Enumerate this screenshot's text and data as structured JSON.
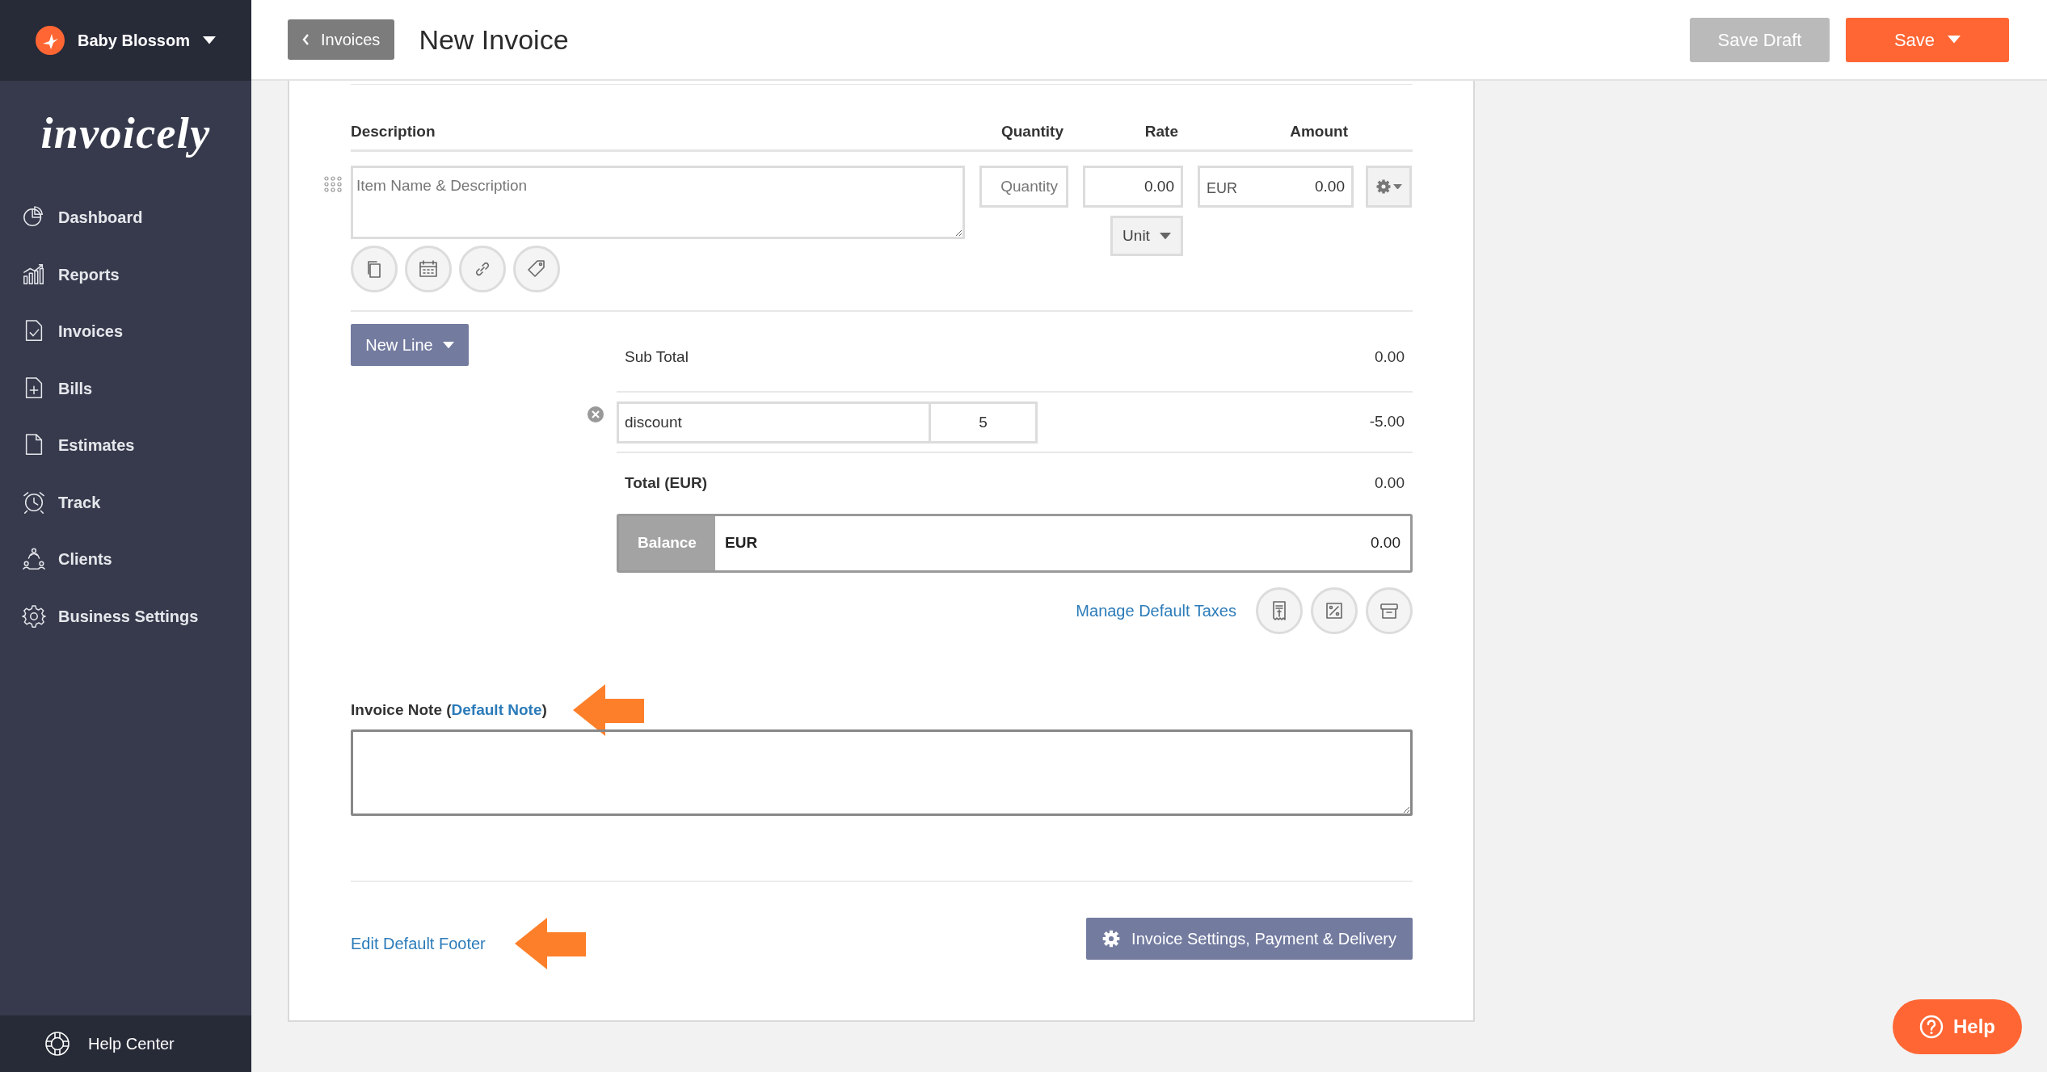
{
  "sidebar": {
    "account": "Baby Blossom",
    "logo": "invoicely",
    "items": [
      {
        "label": "Dashboard"
      },
      {
        "label": "Reports"
      },
      {
        "label": "Invoices"
      },
      {
        "label": "Bills"
      },
      {
        "label": "Estimates"
      },
      {
        "label": "Track"
      },
      {
        "label": "Clients"
      },
      {
        "label": "Business Settings"
      }
    ],
    "footer": "Help Center"
  },
  "header": {
    "back_button": "Invoices",
    "title": "New Invoice",
    "buttons": [
      {
        "label": "Save Draft",
        "kind": "secondary",
        "dropdown": false
      },
      {
        "label": "Save",
        "kind": "primary",
        "dropdown": true
      }
    ]
  },
  "line_items": {
    "columns": [
      "Description",
      "Quantity",
      "Rate",
      "Amount"
    ],
    "rows": [
      {
        "description_placeholder": "Item Name & Description",
        "quantity_placeholder": "Quantity",
        "rate": "0.00",
        "currency": "EUR",
        "amount": "0.00",
        "unit": "Unit"
      }
    ]
  },
  "new_line_button": "New Line",
  "totals": {
    "sub_total": {
      "label": "Sub Total",
      "value": "0.00"
    },
    "discount": {
      "name": "discount",
      "rate": "5",
      "value": "-5.00"
    },
    "total": {
      "label": "Total (EUR)",
      "value": "0.00"
    },
    "balance": {
      "label": "Balance",
      "currency": "EUR",
      "value": "0.00"
    }
  },
  "manage_taxes_link": "Manage Default Taxes",
  "invoice_note": {
    "label": "Invoice Note (",
    "link": "Default Note",
    "suffix": ")"
  },
  "footer_link": "Edit Default Footer",
  "settings_button": "Invoice Settings, Payment & Delivery",
  "help_button": "Help"
}
